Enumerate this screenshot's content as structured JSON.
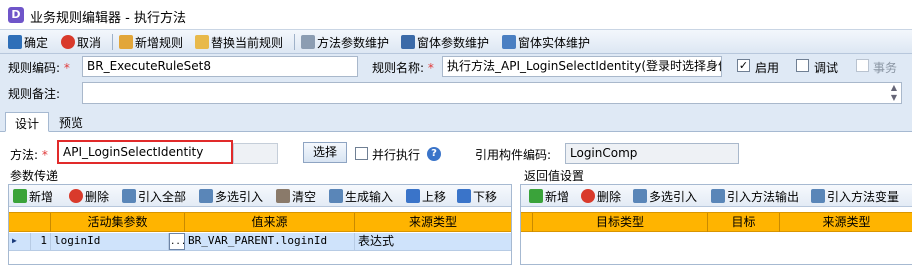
{
  "window": {
    "app_icon_letter": "D",
    "title": "业务规则编辑器 - 执行方法"
  },
  "toolbar": {
    "confirm": "确定",
    "cancel": "取消",
    "new_rule": "新增规则",
    "replace_rule": "替换当前规则",
    "method_params": "方法参数维护",
    "form_params": "窗体参数维护",
    "form_entity": "窗体实体维护"
  },
  "form": {
    "rule_code_label": "规则编码:",
    "rule_code_value": "BR_ExecuteRuleSet8",
    "rule_name_label": "规则名称:",
    "rule_name_value": "执行方法_API_LoginSelectIdentity(登录时选择身份)",
    "enable_label": "启用",
    "debug_label": "调试",
    "transaction_label": "事务",
    "remark_label": "规则备注:",
    "remark_value": "",
    "required_mark": "*"
  },
  "tabs": [
    {
      "label": "设计"
    },
    {
      "label": "预览"
    }
  ],
  "design": {
    "method_label": "方法:",
    "method_value": "API_LoginSelectIdentity",
    "select_button": "选择",
    "parallel_label": "并行执行",
    "help_glyph": "?",
    "component_code_label": "引用构件编码:",
    "component_code_value": "LoginComp"
  },
  "params_panel": {
    "title": "参数传递",
    "toolbar": {
      "add": "新增",
      "delete": "删除",
      "import_all": "引入全部",
      "multi_import": "多选引入",
      "clear": "清空",
      "generate_input": "生成输入",
      "move_up": "上移",
      "move_down": "下移"
    },
    "columns": [
      "活动集参数",
      "值来源",
      "来源类型"
    ],
    "rows": [
      {
        "index": "1",
        "param": "loginId",
        "value": "BR_VAR_PARENT.loginId",
        "source_type": "表达式",
        "ellipsis": "..."
      }
    ]
  },
  "return_panel": {
    "title": "返回值设置",
    "toolbar": {
      "add": "新增",
      "delete": "删除",
      "multi_import": "多选引入",
      "import_method_output": "引入方法输出",
      "import_method_var": "引入方法变量"
    },
    "columns": [
      "目标类型",
      "目标",
      "来源类型"
    ]
  }
}
